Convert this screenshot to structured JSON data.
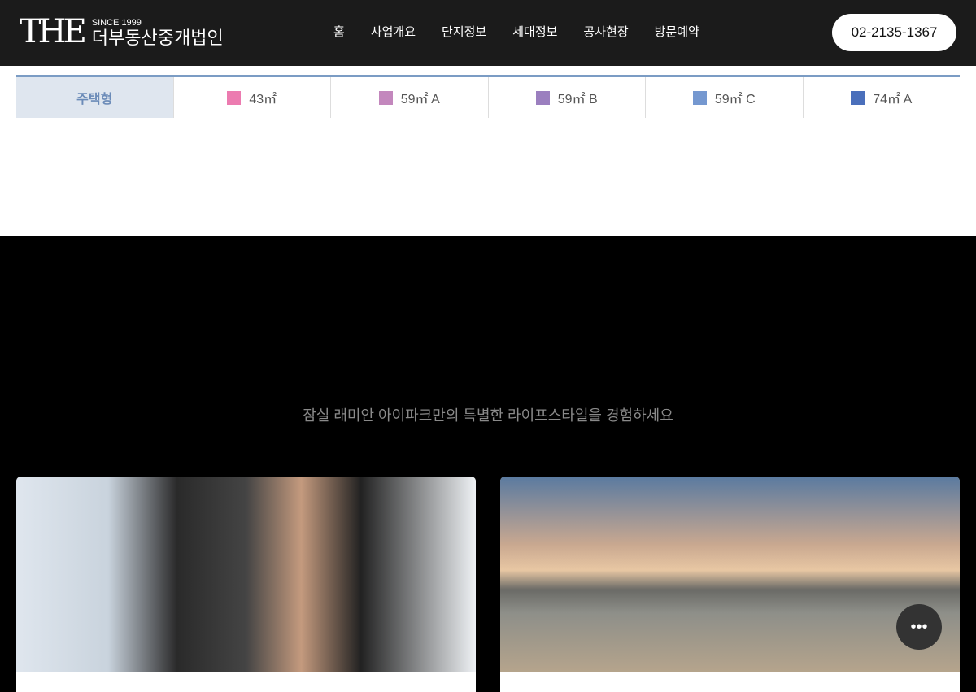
{
  "header": {
    "logo_mark": "THE",
    "logo_since": "SINCE 1999",
    "logo_name": "더부동산중개법인",
    "nav": [
      "홈",
      "사업개요",
      "단지정보",
      "세대정보",
      "공사현장",
      "방문예약"
    ],
    "phone": "02-2135-1367"
  },
  "tabs": {
    "label": "주택형",
    "items": [
      {
        "label": "43㎡",
        "color": "#ec7bb0"
      },
      {
        "label": "59㎡ A",
        "color": "#c387bd"
      },
      {
        "label": "59㎡ B",
        "color": "#9b7fbf"
      },
      {
        "label": "59㎡ C",
        "color": "#7598d0"
      },
      {
        "label": "74㎡ A",
        "color": "#4a6fbb"
      }
    ]
  },
  "lifestyle": {
    "subtitle": "잠실 래미안 아이파크만의 특별한 라이프스타일을 경험하세요"
  }
}
